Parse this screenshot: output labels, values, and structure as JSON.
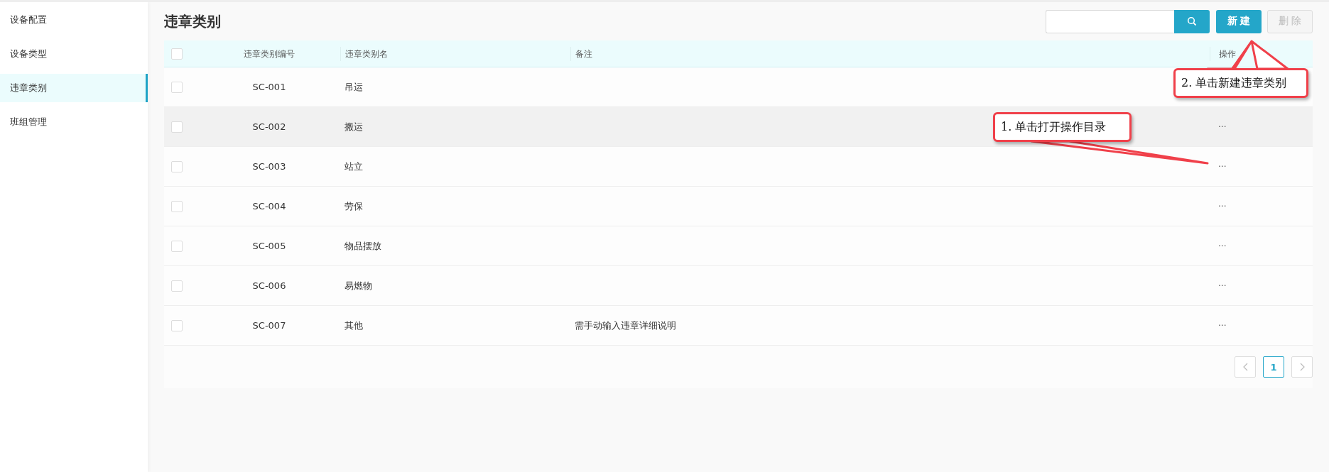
{
  "sidebar": {
    "items": [
      {
        "label": "设备配置",
        "selected": false
      },
      {
        "label": "设备类型",
        "selected": false
      },
      {
        "label": "违章类别",
        "selected": true
      },
      {
        "label": "班组管理",
        "selected": false
      }
    ]
  },
  "page": {
    "title": "违章类别"
  },
  "toolbar": {
    "buttons": [
      {
        "label": "新 建",
        "disabled": false
      },
      {
        "label": "删 除",
        "disabled": true
      }
    ]
  },
  "table": {
    "all_checked": false,
    "columns": [
      "违章类别编号",
      "违章类别名",
      "备注",
      "操作"
    ],
    "rows": [
      {
        "code": "SC-001",
        "name": "吊运",
        "remark": "",
        "checked": false,
        "hovered": false
      },
      {
        "code": "SC-002",
        "name": "搬运",
        "remark": "",
        "action": "···",
        "checked": false,
        "hovered": true
      },
      {
        "code": "SC-003",
        "name": "站立",
        "remark": "",
        "action": "···",
        "checked": false,
        "hovered": false
      },
      {
        "code": "SC-004",
        "name": "劳保",
        "remark": "",
        "action": "···",
        "checked": false,
        "hovered": false
      },
      {
        "code": "SC-005",
        "name": "物品摆放",
        "remark": "",
        "action": "···",
        "checked": false,
        "hovered": false
      },
      {
        "code": "SC-006",
        "name": "易燃物",
        "remark": "",
        "action": "···",
        "checked": false,
        "hovered": false
      },
      {
        "code": "SC-007",
        "name": "其他",
        "remark": "需手动输入违章详细说明",
        "action": "···",
        "checked": false,
        "hovered": false
      }
    ]
  },
  "pagination": {
    "pages": [
      {
        "label": "1",
        "selected": true
      }
    ]
  },
  "callouts": [
    {
      "text": "2. 单击新建违章类别"
    },
    {
      "text": "1. 单击打开操作目录"
    }
  ]
}
